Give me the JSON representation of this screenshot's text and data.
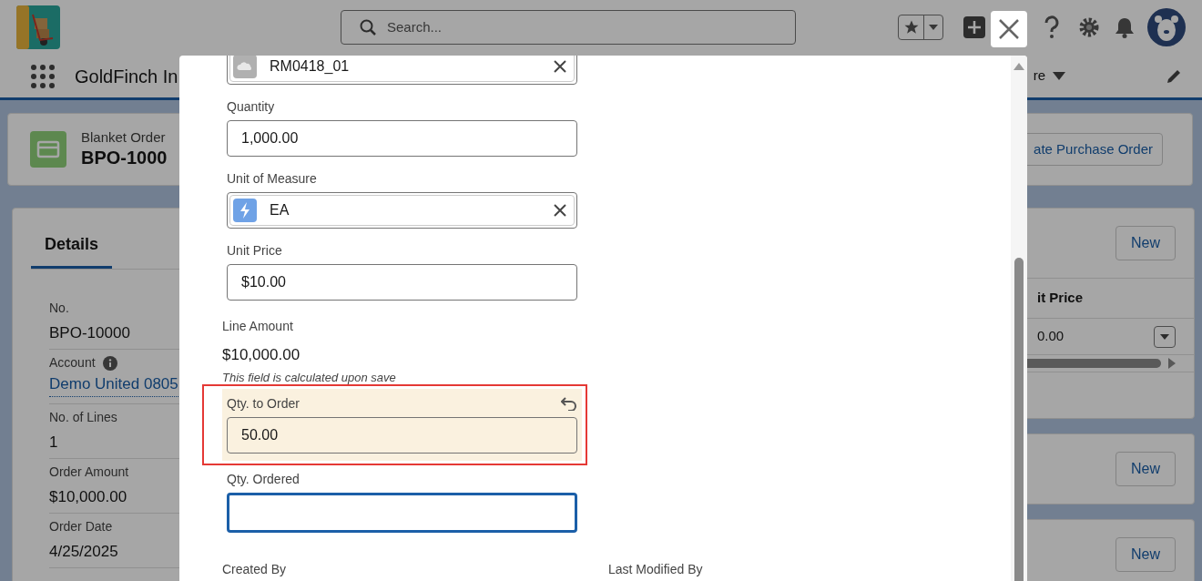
{
  "header": {
    "search": {
      "placeholder": "Search..."
    }
  },
  "nav": {
    "app_name": "GoldFinch In",
    "item": "re"
  },
  "record": {
    "type": "Blanket Order",
    "name": "BPO-1000",
    "action": "ate Purchase Order"
  },
  "details": {
    "tabs": [
      {
        "label": "Details",
        "selected": true
      }
    ],
    "fields": [
      {
        "label": "No.",
        "value": "BPO-10000",
        "kind": "text"
      },
      {
        "label": "Account",
        "value": "Demo United 0805",
        "kind": "link"
      },
      {
        "label": "No. of Lines",
        "value": "1",
        "kind": "text"
      },
      {
        "label": "Order Amount",
        "value": "$10,000.00",
        "kind": "text"
      },
      {
        "label": "Order Date",
        "value": "4/25/2025",
        "kind": "text"
      }
    ]
  },
  "related": [
    {
      "button": "New",
      "column": "it Price",
      "cell": "0.00"
    },
    {
      "button": "New"
    },
    {
      "button": "New"
    }
  ],
  "modal": {
    "fields": [
      {
        "kind": "item_lookup",
        "value": "RM0418_01",
        "edited": false,
        "focused": false,
        "highlighted": false
      },
      {
        "kind": "input",
        "label": "Quantity",
        "value": "1,000.00",
        "edited": false,
        "focused": false,
        "highlighted": false
      },
      {
        "kind": "unit_lookup",
        "label": "Unit of Measure",
        "value": "EA",
        "edited": false,
        "focused": false,
        "highlighted": false
      },
      {
        "kind": "input",
        "label": "Unit Price",
        "value": "$10.00",
        "edited": false,
        "focused": false,
        "highlighted": false
      },
      {
        "kind": "readonly",
        "label": "Line Amount",
        "value": "$10,000.00",
        "note": "This field is calculated upon save"
      },
      {
        "kind": "input",
        "label": "Qty. to Order",
        "value": "50.00",
        "edited": true,
        "focused": false,
        "highlighted": true
      },
      {
        "kind": "input",
        "label": "Qty. Ordered",
        "edited": false,
        "focused": true,
        "highlighted": false
      }
    ],
    "footer": [
      {
        "label": "Created By"
      },
      {
        "label": "Last Modified By"
      }
    ]
  }
}
